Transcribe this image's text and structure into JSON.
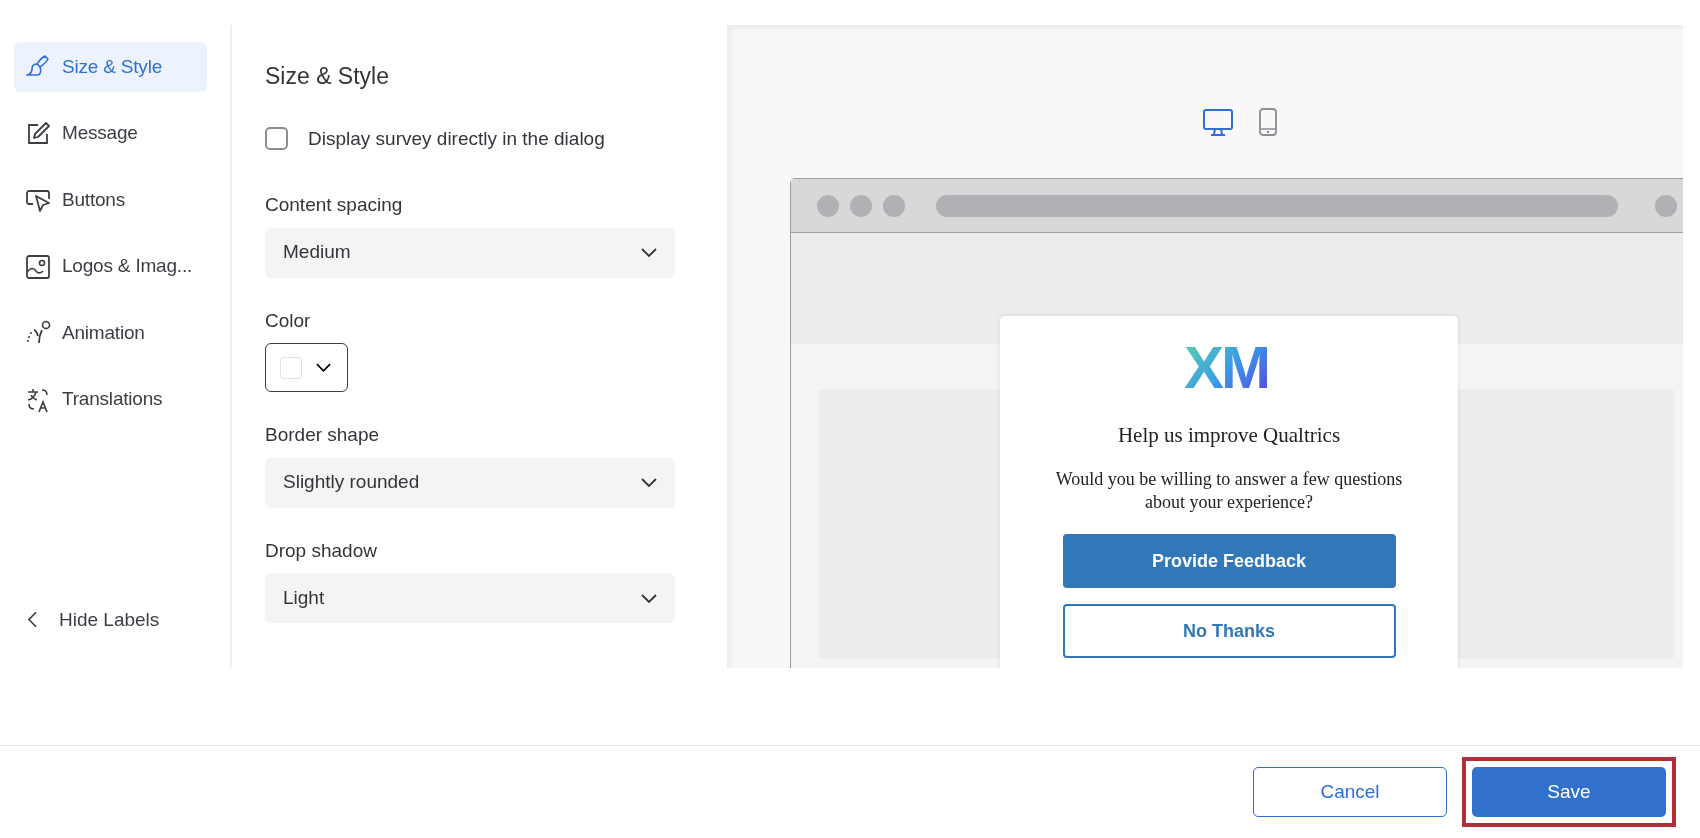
{
  "sidebar": {
    "items": [
      {
        "label": "Size & Style",
        "kind": "brush",
        "selected": true
      },
      {
        "label": "Message",
        "kind": "pencil",
        "selected": false
      },
      {
        "label": "Buttons",
        "kind": "pointer",
        "selected": false
      },
      {
        "label": "Logos & Imag...",
        "kind": "image",
        "selected": false
      },
      {
        "label": "Animation",
        "kind": "motion",
        "selected": false
      },
      {
        "label": "Translations",
        "kind": "translate",
        "selected": false
      }
    ],
    "toggle": {
      "label": "Hide Labels"
    }
  },
  "panel": {
    "title": "Size & Style",
    "checkbox": {
      "label": "Display survey directly in the dialog",
      "checked": false
    },
    "fields": [
      {
        "kind": "select",
        "label": "Content spacing",
        "value": "Medium"
      },
      {
        "kind": "color",
        "label": "Color"
      },
      {
        "kind": "select",
        "label": "Border shape",
        "value": "Slightly rounded"
      },
      {
        "kind": "select",
        "label": "Drop shadow",
        "value": "Light"
      }
    ]
  },
  "preview": {
    "devices": [
      {
        "kind": "desktop",
        "selected": true
      },
      {
        "kind": "mobile",
        "selected": false
      }
    ],
    "dialog": {
      "logo": "XM",
      "title": "Help us improve Qualtrics",
      "message": "Would you be willing to answer a few questions about your experience?",
      "buttons": [
        {
          "label": "Provide Feedback",
          "kind": "primary"
        },
        {
          "label": "No Thanks",
          "kind": "outline"
        }
      ]
    }
  },
  "footer": {
    "buttons": [
      {
        "label": "Cancel",
        "kind": "outline",
        "highlighted": false
      },
      {
        "label": "Save",
        "kind": "primary",
        "highlighted": true
      }
    ]
  }
}
